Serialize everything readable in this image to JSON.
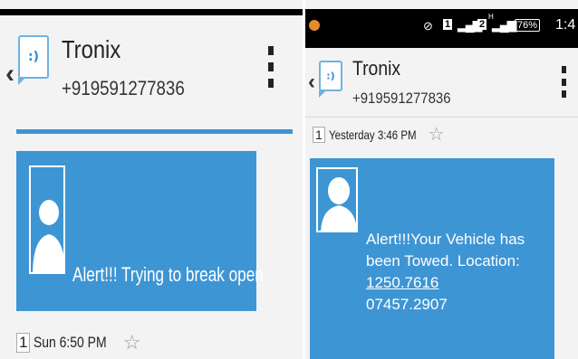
{
  "left": {
    "contact": {
      "name": "Tronix",
      "number": "+919591277836"
    },
    "message": {
      "text": "Alert!!! Trying to break open."
    },
    "meta": {
      "count": "1",
      "time": "Sun 6:50 PM"
    }
  },
  "right": {
    "status": {
      "wifi": "⊘",
      "sim1": "1",
      "sim2": "2",
      "superscript": "H",
      "battery": "76%",
      "time": "1:4"
    },
    "contact": {
      "name": "Tronix",
      "number": "+919591277836"
    },
    "meta": {
      "count": "1",
      "time": "Yesterday 3:46 PM"
    },
    "message": {
      "text_before": "Alert!!!Your Vehicle has been Towed. Location: ",
      "link": "1250.7616",
      "text_after": "07457.2907"
    }
  },
  "icons": {
    "back": "‹",
    "app_face": ":)",
    "star": "☆"
  },
  "colors": {
    "accent": "#3e95d4",
    "header_bg": "#f3f3f3",
    "status_bar": "#000000"
  }
}
